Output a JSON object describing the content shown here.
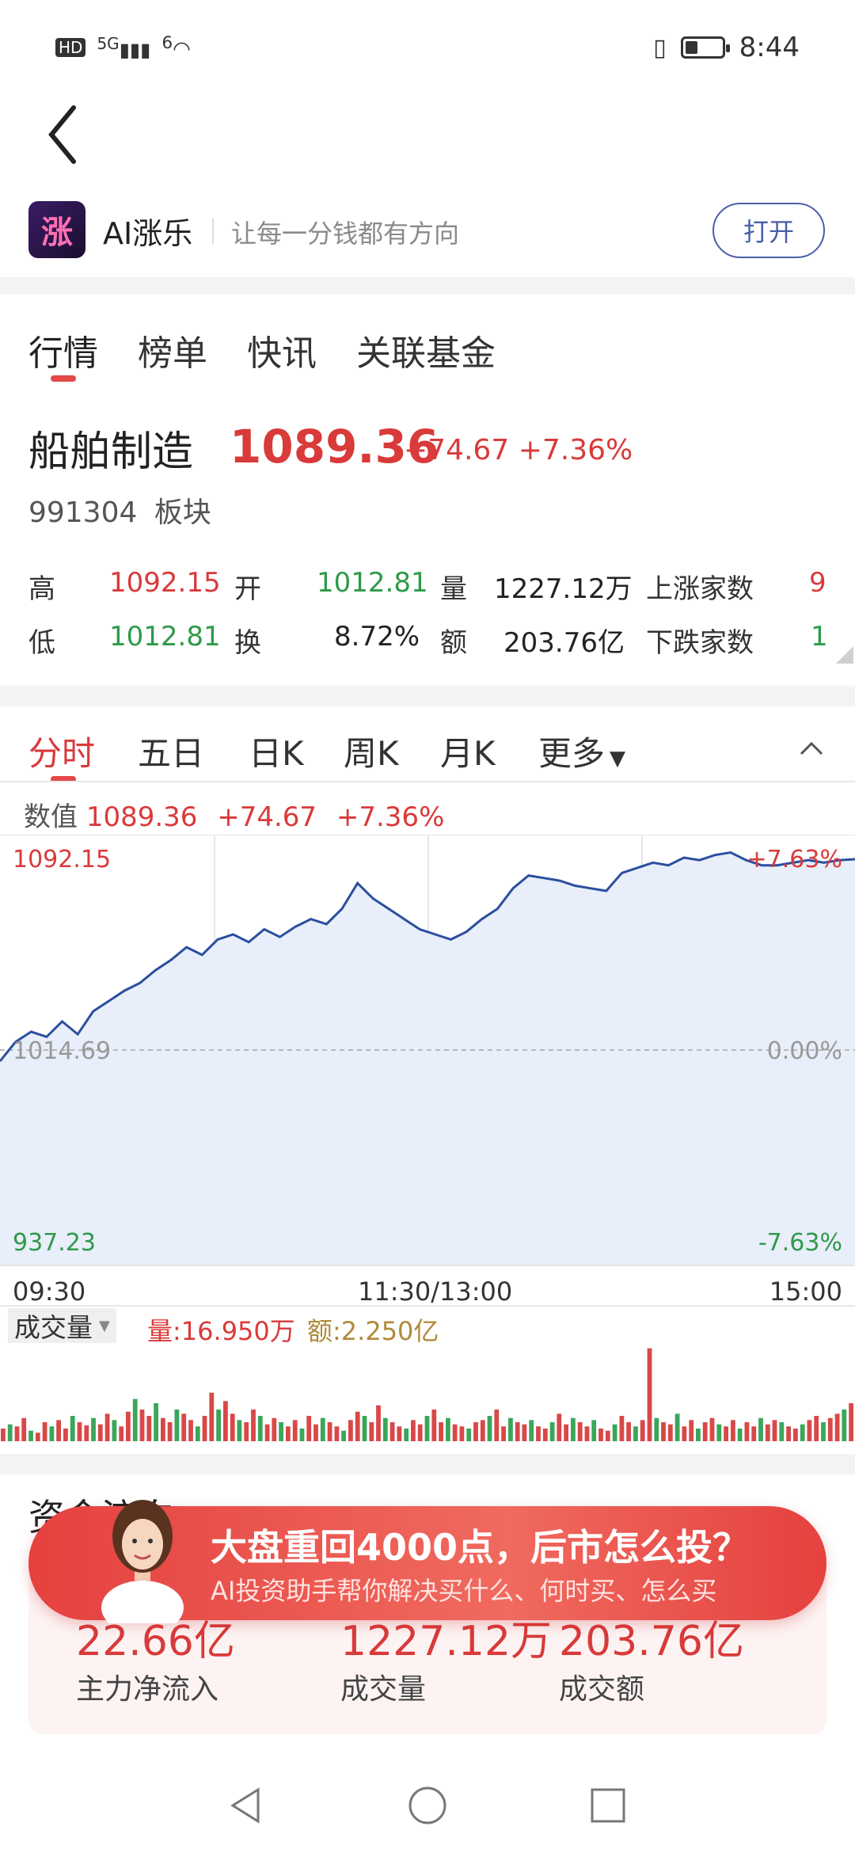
{
  "status_bar": {
    "hd": "HD",
    "signal1": "5G",
    "signal2": "6",
    "time": "8:44",
    "battery_level": 0.35
  },
  "app": {
    "logo_text": "涨",
    "name": "AI涨乐",
    "slogan": "让每一分钱都有方向",
    "open_label": "打开"
  },
  "tabs": [
    "行情",
    "榜单",
    "快讯",
    "关联基金"
  ],
  "quote": {
    "name": "船舶制造",
    "price": "1089.36",
    "change": "+74.67",
    "change_pct": "+7.36%",
    "code": "991304",
    "type": "板块"
  },
  "stats": {
    "high_label": "高",
    "high": "1092.15",
    "open_label": "开",
    "open": "1012.81",
    "vol_label": "量",
    "vol": "1227.12万",
    "up_label": "上涨家数",
    "up": "9",
    "low_label": "低",
    "low": "1012.81",
    "turn_label": "换",
    "turn": "8.72%",
    "amt_label": "额",
    "amt": "203.76亿",
    "down_label": "下跌家数",
    "down": "1"
  },
  "chart_tabs": [
    "分时",
    "五日",
    "日K",
    "周K",
    "月K",
    "更多"
  ],
  "chart_info": {
    "label": "数值",
    "value": "1089.36",
    "change": "+74.67",
    "pct": "+7.36%"
  },
  "chart_data": {
    "type": "line",
    "y_top_label": "1092.15",
    "y_mid_label": "1014.69",
    "y_bottom_label": "937.23",
    "pct_top": "+7.63%",
    "pct_mid": "0.00%",
    "pct_bottom": "-7.63%",
    "x_labels": [
      "09:30",
      "11:30/13:00",
      "15:00"
    ],
    "ylim": [
      937.23,
      1092.15
    ],
    "values": [
      1010.5,
      1018,
      1022,
      1020,
      1026,
      1021,
      1030,
      1034,
      1038,
      1041,
      1046,
      1050,
      1055,
      1052,
      1058,
      1060,
      1057,
      1062,
      1059,
      1063,
      1066,
      1064,
      1070,
      1080,
      1074,
      1070,
      1066,
      1062,
      1060,
      1058,
      1061,
      1066,
      1070,
      1078,
      1083,
      1082,
      1081,
      1079,
      1078,
      1077,
      1084,
      1086,
      1088,
      1087,
      1090,
      1089,
      1091,
      1092,
      1089,
      1087,
      1087,
      1088,
      1089,
      1088,
      1089,
      1089.36
    ],
    "volume": {
      "label": "成交量",
      "vol_label": "量:",
      "vol": "16.950万",
      "amt_label": "额:",
      "amt": "2.250亿",
      "values": [
        12,
        16,
        14,
        22,
        10,
        8,
        18,
        14,
        20,
        12,
        24,
        18,
        15,
        22,
        16,
        26,
        20,
        14,
        28,
        40,
        30,
        24,
        36,
        22,
        18,
        30,
        26,
        20,
        14,
        24,
        46,
        30,
        38,
        26,
        20,
        18,
        30,
        24,
        16,
        22,
        18,
        14,
        20,
        12,
        24,
        16,
        22,
        18,
        14,
        10,
        20,
        28,
        24,
        18,
        34,
        22,
        18,
        14,
        12,
        20,
        16,
        24,
        30,
        18,
        22,
        16,
        14,
        12,
        18,
        20,
        24,
        30,
        14,
        22,
        18,
        16,
        20,
        14,
        12,
        18,
        26,
        16,
        22,
        18,
        14,
        20,
        12,
        10,
        16,
        24,
        18,
        14,
        20,
        88,
        22,
        18,
        16,
        26,
        14,
        20,
        12,
        18,
        22,
        16,
        14,
        20,
        12,
        18,
        14,
        22,
        16,
        20,
        18,
        14,
        12,
        16,
        20,
        24,
        18,
        22,
        26,
        30,
        36
      ]
    }
  },
  "fund_flow": {
    "title": "资金流向",
    "items": [
      {
        "value": "22.66亿",
        "label": "主力净流入"
      },
      {
        "value": "1227.12万",
        "label": "成交量"
      },
      {
        "value": "203.76亿",
        "label": "成交额"
      }
    ]
  },
  "promo": {
    "title": "大盘重回4000点，后市怎么投？",
    "subtitle": "AI投资助手帮你解决买什么、何时买、怎么买"
  }
}
